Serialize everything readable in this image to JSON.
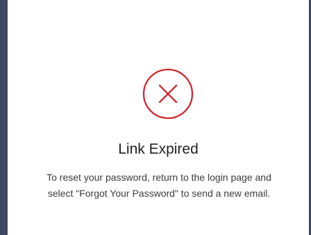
{
  "dialog": {
    "title": "Link Expired",
    "message": "To reset your password, return to the login page and select \"Forgot Your Password\" to send a new email.",
    "icon": "error-x-icon",
    "accent_color": "#d0262e",
    "sidebar_color": "#3e4663"
  }
}
